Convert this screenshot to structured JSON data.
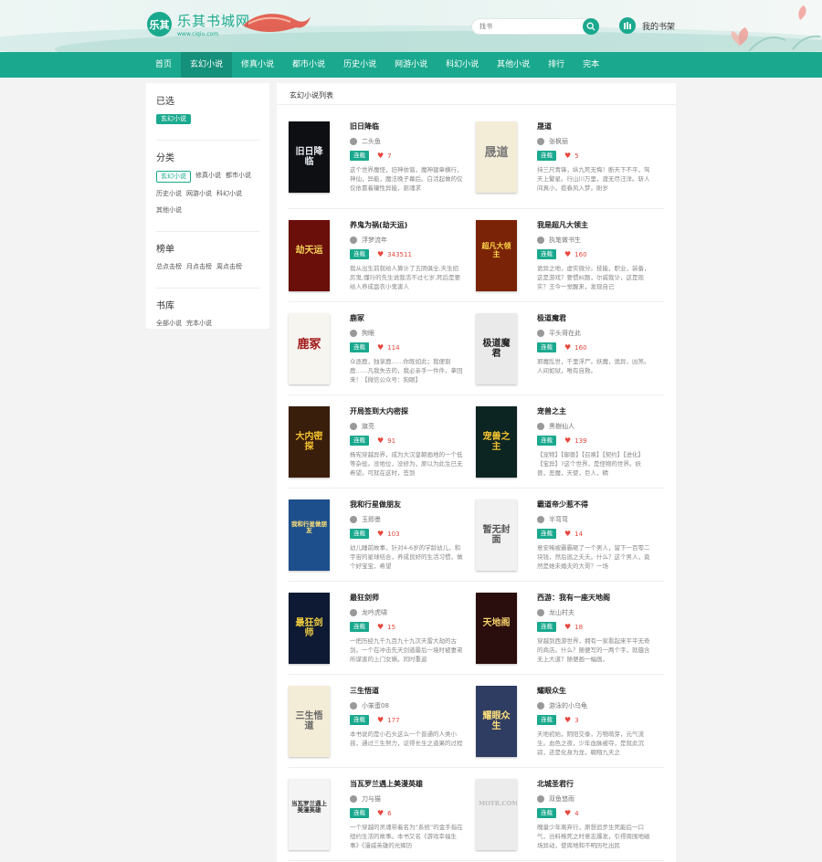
{
  "logo": {
    "mark": "乐其",
    "name": "乐其书城网",
    "url": "www.ciqiu.com"
  },
  "search": {
    "placeholder": "找书"
  },
  "shelf": {
    "label": "我的书架"
  },
  "nav": [
    {
      "label": "首页"
    },
    {
      "label": "玄幻小说"
    },
    {
      "label": "修真小说"
    },
    {
      "label": "都市小说"
    },
    {
      "label": "历史小说"
    },
    {
      "label": "网游小说"
    },
    {
      "label": "科幻小说"
    },
    {
      "label": "其他小说"
    },
    {
      "label": "排行"
    },
    {
      "label": "完本"
    }
  ],
  "sidebar": {
    "selected": {
      "title": "已选",
      "tags": [
        "玄幻小说"
      ]
    },
    "category": {
      "title": "分类",
      "tags": [
        "玄幻小说",
        "修真小说",
        "都市小说",
        "历史小说",
        "网游小说",
        "科幻小说",
        "其他小说"
      ]
    },
    "rank": {
      "title": "榜单",
      "tags": [
        "总点击榜",
        "月点击榜",
        "周点击榜"
      ]
    },
    "library": {
      "title": "书库",
      "tags": [
        "全部小说",
        "完本小说"
      ]
    }
  },
  "main": {
    "heading": "玄幻小说列表"
  },
  "status_label": "连载",
  "books": [
    {
      "title": "旧日降临",
      "author": "二头鱼",
      "likes": "7",
      "desc": "这个世界魔怪，旧神依谐，魔神建章横行，神仙，异能，魔法晚子幕后。白活起做的仅仅依靠着罐性异能，驱魂求",
      "cover": {
        "bg": "#0d0f12",
        "fg": "#e8ecf2",
        "text": "旧日降临"
      }
    },
    {
      "title": "晟道",
      "author": "张枫丽",
      "likes": "5",
      "desc": "持三尺青锋，纵九死无悔！断天下不平，驾天上繁星。行山川万里，渡无尽汪洋。斩人间真小，揽春风入梦。盼岁",
      "cover": {
        "bg": "#f3ecd6",
        "fg": "#777",
        "text": "晟道"
      }
    },
    {
      "title": "养鬼为祸(劫天运)",
      "author": "浮梦流年",
      "likes": "343511",
      "desc": "我从出生前就给人算计了五阴俱全,天生招厉鬼,懂行的先生说我活不过七岁,死后是要给人养成盘衣小鬼害人",
      "cover": {
        "bg": "#6b0f0a",
        "fg": "#f4d25a",
        "text": "劫天运"
      }
    },
    {
      "title": "我是超凡大领主",
      "author": "执笔做书生",
      "likes": "160",
      "desc": "诡异之地，虚实微分。技能，职业，装备，这是游戏？要惯纠题，尔威我讣，这是现实？王今一觉醒来，发现自己",
      "cover": {
        "bg": "#7a2306",
        "fg": "#ffd74a",
        "text": "超凡大领主"
      }
    },
    {
      "title": "鹿冢",
      "author": "狗眼",
      "likes": "114",
      "desc": "众逐鹿，独享鹿……你既如此；我便割鹿……凡我失去的，我必亲手一件件，拿回来！【微信公众号：狗眼】",
      "cover": {
        "bg": "#f7f5f0",
        "fg": "#a01818",
        "text": "鹿冢"
      }
    },
    {
      "title": "极道魔君",
      "author": "平头哥在此",
      "likes": "160",
      "desc": "邪魔乱世，千里浮尸。妖魔，诡异，凶煞。人间如狱，唯有自救。",
      "cover": {
        "bg": "#eaeaea",
        "fg": "#222",
        "text": "极道魔君"
      }
    },
    {
      "title": "开局签到大内密探",
      "author": "旗亮",
      "likes": "91",
      "desc": "杨宪穿越异界，成为大汉皇朝画地的一个低等杂役。没地位，没修为，原以为此生已无希望。可就在这时，签到",
      "cover": {
        "bg": "#3a1e0c",
        "fg": "#f2c12e",
        "text": "大内密探"
      }
    },
    {
      "title": "宠兽之主",
      "author": "黑樹仙人",
      "likes": "139",
      "desc": "【宠物】【御兽】【召唤】【契约】【进化】【宝异】?这个世界，是怪物的世界。妖兽，恶魔，天使，巨人，精",
      "cover": {
        "bg": "#0c2422",
        "fg": "#f3c230",
        "text": "宠兽之主"
      }
    },
    {
      "title": "我和行星做朋友",
      "author": "玉即墨",
      "likes": "103",
      "desc": "幼儿睡前故事，针对4-6岁的学龄幼儿，和宇宙的星球结合，养成良好的生活习惯，做个好宝宝，希望",
      "cover": {
        "bg": "#1d4f8c",
        "fg": "#ffe27a",
        "text": "我和行星做朋友"
      }
    },
    {
      "title": "霸道帝少惹不得",
      "author": "半弯弯",
      "likes": "14",
      "desc": "意安稀被霸霸砸了一个男人，留下一百零二块钱，然后逃之夭夭。什么？这个男人，竟然是她未婚夫的大哥？一场",
      "cover": {
        "bg": "#f1f1f1",
        "fg": "#555",
        "text": "暂无封面"
      }
    },
    {
      "title": "最狂剑师",
      "author": "龙吟虎啸",
      "likes": "15",
      "desc": "一把历经九千九百九十九次天雷大劫的古剑。一个在冲击先天剑道最后一境时被妻弟所谋害的上门女婿。同时重返",
      "cover": {
        "bg": "#0e1a33",
        "fg": "#f5d040",
        "text": "最狂剑师"
      }
    },
    {
      "title": "西游：我有一座天地阁",
      "author": "龙山村夫",
      "likes": "18",
      "desc": "穿越到西游世界，拥有一家看起来平平无奇的商店。什么？随便写的一两个字，就蕴含无上大道？随便画一幅画，",
      "cover": {
        "bg": "#2a0d0d",
        "fg": "#f4d26a",
        "text": "天地阁"
      }
    },
    {
      "title": "三生悟道",
      "author": "小笨蛋08",
      "likes": "177",
      "desc": "本书说的是小石头这么一个普通的人类小孩，通过三生努力，证得长生之道果的过程",
      "cover": {
        "bg": "#f3ecd6",
        "fg": "#666",
        "text": "三生悟道"
      }
    },
    {
      "title": "耀眼众生",
      "author": "游泳的小乌龟",
      "likes": "3",
      "desc": "天地初始，阴阳交泰，万物萌芽，元气流生。血色之夜，少年血脉被夺，是就此沉寂，还是化身为龙，翱翔九天之",
      "cover": {
        "bg": "#2f3d63",
        "fg": "#ffe07a",
        "text": "耀眼众生"
      }
    },
    {
      "title": "当瓦罗兰遇上美漫英雄",
      "author": "刀与猫",
      "likes": "6",
      "desc": "一个穿越的灵魂带着名为“系统”的金手指在纽约生活的故事。本书又名《游戏幸福生事》《漫威英雄的光辉历",
      "cover": {
        "bg": "#f4f4f4",
        "fg": "#333",
        "text": "当瓦罗兰遇上美漫英雄"
      }
    },
    {
      "title": "北城圣君行",
      "author": "双鱼悠雨",
      "likes": "4",
      "desc": "魄量少年离弃行，原想追步生死能后一口气，岂料格死之时意志爆发，引得周围地磁场异动，使周地和不明历吐出民",
      "cover": {
        "bg": "#ececec",
        "fg": "#bbb",
        "text": "MOTR.COM"
      }
    }
  ]
}
